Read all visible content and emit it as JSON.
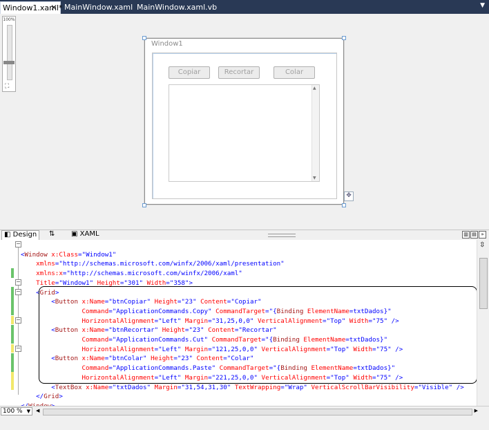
{
  "tabs": [
    {
      "label": "Window1.xaml*",
      "active": true
    },
    {
      "label": "MainWindow.xaml",
      "active": false
    },
    {
      "label": "MainWindow.xaml.vb",
      "active": false
    }
  ],
  "designer": {
    "zoom_label": "100%",
    "window_title": "Window1",
    "buttons": [
      "Copiar",
      "Recortar",
      "Colar"
    ]
  },
  "splitter": {
    "design_tab": "Design",
    "swap_icon": "swap-arrows-icon",
    "xaml_tab": "XAML"
  },
  "code_lines": [
    "<Window x:Class=\"Window1\"",
    "    xmlns=\"http://schemas.microsoft.com/winfx/2006/xaml/presentation\"",
    "    xmlns:x=\"http://schemas.microsoft.com/winfx/2006/xaml\"",
    "    Title=\"Window1\" Height=\"301\" Width=\"358\">",
    "    <Grid>",
    "        <Button x:Name=\"btnCopiar\" Height=\"23\" Content=\"Copiar\"",
    "                Command=\"ApplicationCommands.Copy\" CommandTarget=\"{Binding ElementName=txtDados}\"",
    "                HorizontalAlignment=\"Left\" Margin=\"31,25,0,0\" VerticalAlignment=\"Top\" Width=\"75\" />",
    "        <Button x:Name=\"btnRecortar\" Height=\"23\" Content=\"Recortar\"",
    "                Command=\"ApplicationCommands.Cut\" CommandTarget=\"{Binding ElementName=txtDados}\"",
    "                HorizontalAlignment=\"Left\" Margin=\"121,25,0,0\" VerticalAlignment=\"Top\" Width=\"75\" />",
    "        <Button x:Name=\"btnColar\" Height=\"23\" Content=\"Colar\"",
    "                Command=\"ApplicationCommands.Paste\" CommandTarget=\"{Binding ElementName=txtDados}\"",
    "                HorizontalAlignment=\"Left\" Margin=\"221,25,0,0\" VerticalAlignment=\"Top\" Width=\"75\" />",
    "        <TextBox x:Name=\"txtDados\" Margin=\"31,54,31,30\" TextWrapping=\"Wrap\" VerticalScrollBarVisibility=\"Visible\" />",
    "    </Grid>",
    "</Window>"
  ],
  "bottom": {
    "zoom_value": "100 %"
  },
  "colors": {
    "tabbar": "#293955",
    "keyword": "#0000ff",
    "element": "#a31515",
    "attribute": "#ff0000"
  }
}
